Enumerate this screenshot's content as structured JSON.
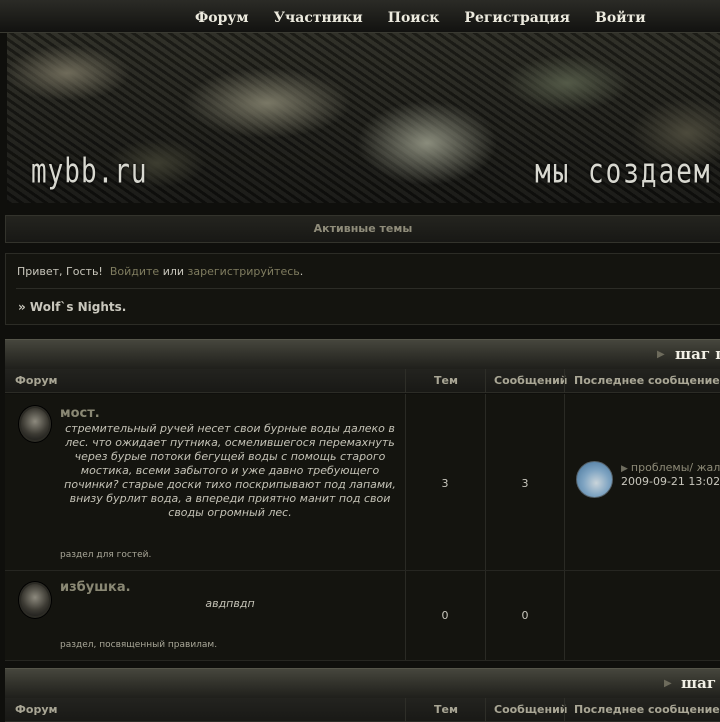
{
  "nav": {
    "items": [
      "Форум",
      "Участники",
      "Поиск",
      "Регистрация",
      "Войти"
    ]
  },
  "banner": {
    "logo": "mybb.ru",
    "tagline": "мы создаем общ"
  },
  "active_topics": "Активные темы",
  "welcome": {
    "greeting": "Привет, Гость!",
    "login_link": "Войдите",
    "or_text": "или",
    "register_link": "зарегистрируйтесь",
    "period": "."
  },
  "breadcrumb": "» Wolf`s Nights.",
  "categories": [
    {
      "title": "шаг п",
      "columns": [
        "Форум",
        "Тем",
        "Сообщений",
        "Последнее сообщение"
      ],
      "forums": [
        {
          "name": "мост.",
          "description": "стремительный ручей несет свои бурные воды далеко в лес. что ожидает путника, осмелившегося перемахнуть через бурые потоки бегущей воды с помощь старого мостика, всеми забытого и уже давно требующего починки? старые доски тихо поскрипывают под лапами, внизу бурлит вода, а впереди приятно манит под свои своды огромный лес.",
          "note": "раздел для гостей.",
          "topics": "3",
          "posts": "3",
          "last_post": {
            "title": "проблемы/ жал",
            "date": "2009-09-21 13:02"
          }
        },
        {
          "name": "избушка.",
          "description": "авдпвдп",
          "note": "раздел, посвященный правилам.",
          "topics": "0",
          "posts": "0"
        }
      ]
    },
    {
      "title": "шаг",
      "columns": [
        "Форум",
        "Тем",
        "Сообщений",
        "Последнее сообщение"
      ]
    }
  ],
  "colors": {
    "background": "#0f0f0c",
    "link": "#8a8874",
    "text": "#c9c7bd"
  },
  "icons": {
    "forum_status": "forum-status-icon",
    "breadcrumb_arrow": "breadcrumb-arrow-icon",
    "category_arrow": "category-arrow-icon",
    "last_post_arrow": "last-post-arrow-icon"
  }
}
